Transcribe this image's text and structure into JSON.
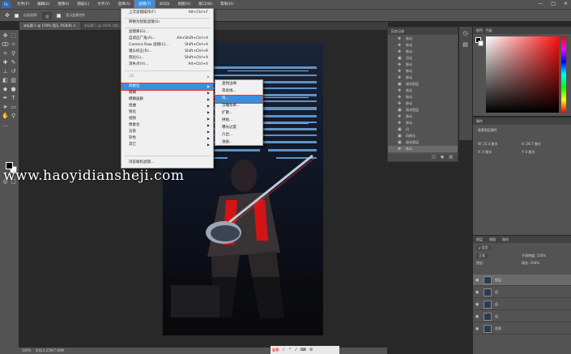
{
  "app": {
    "logo": "Ps"
  },
  "menubar": {
    "items": [
      "文件(F)",
      "编辑(E)",
      "图像(I)",
      "图层(L)",
      "文字(Y)",
      "选择(S)",
      "滤镜(T)",
      "3D(D)",
      "视图(V)",
      "窗口(W)",
      "帮助(H)"
    ],
    "active_index": 6,
    "window_controls": [
      "—",
      "□",
      "✕"
    ]
  },
  "optbar": {
    "auto_select": "自动选择:",
    "group": "组",
    "transform": "显示变换控件"
  },
  "tabs": [
    {
      "label": "未标题-1 @ 100% (组1, RGB/8) ×"
    },
    {
      "label": "未标题-1 @ 100% (组1, RGB/8#) ×"
    }
  ],
  "filter_menu": {
    "items": [
      {
        "label": "上次滤镜操作(F)",
        "shortcut": "Alt+Ctrl+F",
        "state": "normal"
      },
      {
        "label": "转换为智能滤镜(S)",
        "shortcut": "",
        "state": "normal"
      },
      {
        "label": "滤镜库(G)...",
        "shortcut": "",
        "state": "normal"
      },
      {
        "label": "自适应广角(A)...",
        "shortcut": "Alt+Shift+Ctrl+A",
        "state": "normal"
      },
      {
        "label": "Camera Raw 滤镜(C)...",
        "shortcut": "Shift+Ctrl+A",
        "state": "normal"
      },
      {
        "label": "镜头校正(R)...",
        "shortcut": "Shift+Ctrl+R",
        "state": "normal"
      },
      {
        "label": "液化(L)...",
        "shortcut": "Shift+Ctrl+X",
        "state": "normal"
      },
      {
        "label": "消失点(V)...",
        "shortcut": "Alt+Ctrl+V",
        "state": "normal"
      },
      {
        "label": "3D",
        "shortcut": "",
        "state": "disabled"
      },
      {
        "label": "风格化",
        "shortcut": "",
        "state": "highlight",
        "submenu": true
      },
      {
        "label": "模糊",
        "shortcut": "",
        "state": "normal",
        "submenu": true
      },
      {
        "label": "模糊画廊",
        "shortcut": "",
        "state": "normal",
        "submenu": true
      },
      {
        "label": "扭曲",
        "shortcut": "",
        "state": "normal",
        "submenu": true
      },
      {
        "label": "锐化",
        "shortcut": "",
        "state": "normal",
        "submenu": true
      },
      {
        "label": "视频",
        "shortcut": "",
        "state": "normal",
        "submenu": true
      },
      {
        "label": "像素化",
        "shortcut": "",
        "state": "normal",
        "submenu": true
      },
      {
        "label": "渲染",
        "shortcut": "",
        "state": "normal",
        "submenu": true
      },
      {
        "label": "杂色",
        "shortcut": "",
        "state": "normal",
        "submenu": true
      },
      {
        "label": "其它",
        "shortcut": "",
        "state": "normal",
        "submenu": true
      },
      {
        "label": "浏览联机滤镜...",
        "shortcut": "",
        "state": "normal"
      }
    ]
  },
  "submenu": {
    "items": [
      {
        "label": "查找边缘",
        "state": "normal"
      },
      {
        "label": "等高线...",
        "state": "normal"
      },
      {
        "label": "风...",
        "state": "highlight"
      },
      {
        "label": "浮雕效果...",
        "state": "normal"
      },
      {
        "label": "扩散...",
        "state": "normal"
      },
      {
        "label": "拼贴...",
        "state": "normal"
      },
      {
        "label": "曝光过度",
        "state": "normal"
      },
      {
        "label": "凸出...",
        "state": "normal"
      },
      {
        "label": "油画...",
        "state": "normal"
      }
    ]
  },
  "history": {
    "title": "历史记录",
    "rows": [
      "移动",
      "移动",
      "移动",
      "羽化",
      "移动",
      "移动",
      "移动",
      "填充图层",
      "移动",
      "移动",
      "移动",
      "填充图层",
      "移动",
      "移动",
      "风",
      "风格化",
      "填充图层",
      "移动"
    ],
    "selected_index": 17
  },
  "color_panel": {
    "title": "颜色",
    "tab2": "色板"
  },
  "properties": {
    "title": "属性",
    "layer_type": "像素图层属性",
    "w_label": "W: 25.4 厘米",
    "h_label": "H: 28.7 厘米",
    "x_label": "X: 0 厘米",
    "y_label": "Y: 0 厘米"
  },
  "layers": {
    "tabs": [
      "图层",
      "通道",
      "路径"
    ],
    "kind": "ρ 类型",
    "blend": "正常",
    "opacity": "不透明度: 100%",
    "lock": "锁定:",
    "fill": "填充: 100%",
    "rows": [
      {
        "name": "图层",
        "selected": true
      },
      {
        "name": "组",
        "selected": false
      },
      {
        "name": "组",
        "selected": false
      },
      {
        "name": "组",
        "selected": false
      },
      {
        "name": "背景",
        "selected": false
      }
    ]
  },
  "status": {
    "zoom": "100%",
    "doc": "文档:2.25M/7.60M"
  },
  "watermark": "www.haoyidiansheji.com",
  "tray": {
    "label": "S中"
  }
}
